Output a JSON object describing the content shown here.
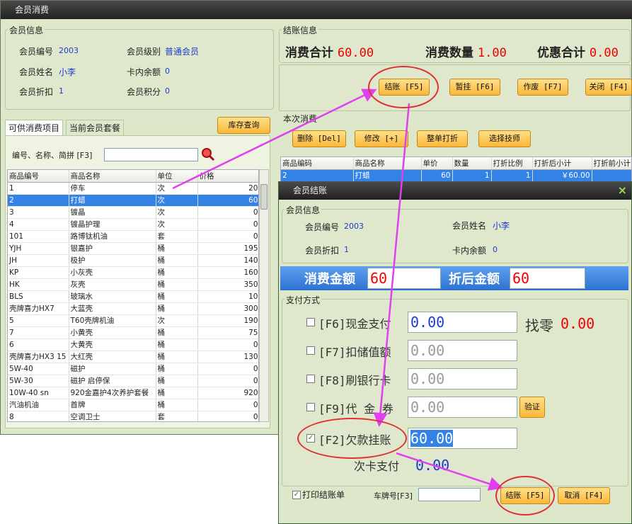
{
  "window_title": "会员消费",
  "member_info": {
    "group": "会员信息",
    "id_label": "会员编号",
    "id": "2003",
    "level_label": "会员级别",
    "level": "普通会员",
    "name_label": "会员姓名",
    "name": "小李",
    "balance_label": "卡内余额",
    "balance": "0",
    "discount_label": "会员折扣",
    "discount": "1",
    "points_label": "会员积分",
    "points": "0"
  },
  "tabs": [
    "可供消费项目",
    "当前会员套餐"
  ],
  "stock_button": "库存查询",
  "search": {
    "label": "编号、名称、简拼 [F3]",
    "value": ""
  },
  "product_table": {
    "headers": [
      "商品编号",
      "商品名称",
      "单位",
      "价格"
    ],
    "rows": [
      [
        "1",
        "停车",
        "次",
        "20"
      ],
      [
        "2",
        "打蜡",
        "次",
        "60"
      ],
      [
        "3",
        "镀晶",
        "次",
        "0"
      ],
      [
        "4",
        "镀晶护理",
        "次",
        "0"
      ],
      [
        "101",
        "路博钛机油",
        "套",
        "0"
      ],
      [
        "YJH",
        "银嘉护",
        "桶",
        "195"
      ],
      [
        "JH",
        "极护",
        "桶",
        "140"
      ],
      [
        "KP",
        "小灰壳",
        "桶",
        "160"
      ],
      [
        "HK",
        "灰壳",
        "桶",
        "350"
      ],
      [
        "BLS",
        "玻璃水",
        "桶",
        "10"
      ],
      [
        "壳牌喜力HX7",
        "大蓝壳",
        "桶",
        "300"
      ],
      [
        "5",
        "T60壳牌机油",
        "次",
        "190"
      ],
      [
        "7",
        "小黄壳",
        "桶",
        "75"
      ],
      [
        "6",
        "大黄壳",
        "桶",
        "0"
      ],
      [
        "壳牌喜力HX3 15",
        "大红壳",
        "桶",
        "130"
      ],
      [
        "5W-40",
        "磁护",
        "桶",
        "0"
      ],
      [
        "5W-30",
        "磁护 启停保",
        "桶",
        "0"
      ],
      [
        "10W-40 sn",
        "920金嘉护4次养护套餐",
        "桶",
        "920"
      ],
      [
        "汽油机油",
        "首牌",
        "桶",
        "0"
      ],
      [
        "8",
        "空调卫士",
        "套",
        "0"
      ]
    ],
    "selected_index": 1
  },
  "checkout": {
    "group": "结账信息",
    "total_label": "消费合计",
    "total": "60.00",
    "qty_label": "消费数量",
    "qty": "1.00",
    "discount_label": "优惠合计",
    "discount": "0.00"
  },
  "top_buttons": [
    "结账 [F5]",
    "暂挂 [F6]",
    "作废 [F7]",
    "关闭 [F4]"
  ],
  "current": {
    "group": "本次消费",
    "buttons": [
      "删除 [Del]",
      "修改 [+]",
      "整单打折",
      "选择技师"
    ],
    "headers": [
      "商品编码",
      "商品名称",
      "单价",
      "数量",
      "打折比例",
      "打折后小计",
      "打折前小计"
    ],
    "row": [
      "2",
      "打蜡",
      "60",
      "1",
      "1",
      "￥60.00",
      ""
    ]
  },
  "dialog": {
    "title": "会员结账",
    "close_icon": "×",
    "member_group": "会员信息",
    "id_label": "会员编号",
    "id": "2003",
    "name_label": "会员姓名",
    "name": "小李",
    "discount_label": "会员折扣",
    "discount": "1",
    "balance_label": "卡内余额",
    "balance": "0",
    "amount_label": "消费金额",
    "amount": "60",
    "after_label": "折后金额",
    "after": "60",
    "pay_group": "支付方式",
    "pays": [
      {
        "label": "[F6]现金支付",
        "value": "0.00",
        "checked": false
      },
      {
        "label": "[F7]扣储值额",
        "value": "0.00",
        "checked": false
      },
      {
        "label": "[F8]刷银行卡",
        "value": "0.00",
        "checked": false
      },
      {
        "label": "[F9]代 金 券",
        "value": "0.00",
        "checked": false
      },
      {
        "label": "[F2]欠款挂账",
        "value": "60.00",
        "checked": true
      }
    ],
    "change_label": "找零",
    "change": "0.00",
    "verify_button": "验证",
    "times_label": "次卡支付",
    "times": "0.00",
    "print_label": "打印结账单",
    "plate_label": "车牌号[F3]",
    "plate": "",
    "confirm_button": "结账 [F5]",
    "cancel_button": "取消 [F4]"
  },
  "colors": {
    "accent_orange": "#fbb73a",
    "selection_blue": "#3382e6",
    "annotation_magenta": "#e040f0",
    "annotation_red": "#e03030"
  }
}
